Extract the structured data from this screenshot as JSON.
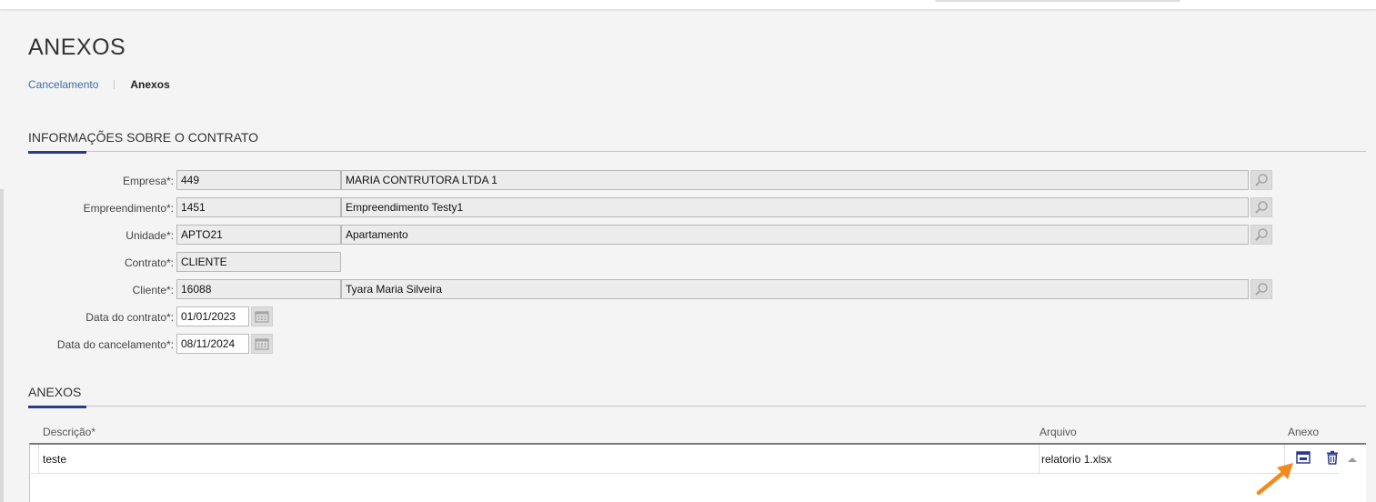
{
  "page": {
    "title": "ANEXOS"
  },
  "breadcrumb": {
    "link": "Cancelamento",
    "current": "Anexos"
  },
  "section_contract": {
    "title": "INFORMAÇÕES SOBRE O CONTRATO"
  },
  "form": {
    "empresa": {
      "label": "Empresa*:",
      "code": "449",
      "name": "MARIA CONTRUTORA LTDA 1"
    },
    "empreendimento": {
      "label": "Empreendimento*:",
      "code": "1451",
      "name": "Empreendimento Testy1"
    },
    "unidade": {
      "label": "Unidade*:",
      "code": "APTO21",
      "name": "Apartamento"
    },
    "contrato": {
      "label": "Contrato*:",
      "code": "CLIENTE"
    },
    "cliente": {
      "label": "Cliente*:",
      "code": "16088",
      "name": "Tyara Maria Silveira"
    },
    "data_contrato": {
      "label": "Data do contrato*:",
      "value": "01/01/2023"
    },
    "data_cancelamento": {
      "label": "Data do cancelamento*:",
      "value": "08/11/2024"
    }
  },
  "section_anexos": {
    "title": "ANEXOS"
  },
  "grid": {
    "columns": {
      "descricao": "Descrição*",
      "arquivo": "Arquivo",
      "anexo": "Anexo"
    },
    "rows": [
      {
        "descricao": "teste",
        "arquivo": "relatorio 1.xlsx"
      }
    ]
  },
  "colors": {
    "accent": "#2b3a8c",
    "link": "#3a6ea5",
    "arrow": "#f28a1e",
    "icon_blue": "#2b3a8c"
  },
  "icons": {
    "lookup": "magnifier-icon",
    "calendar": "calendar-icon",
    "attachment": "view-attachment-icon",
    "delete": "trash-icon",
    "scroll": "scroll-up-icon",
    "pointer": "arrow-icon"
  }
}
